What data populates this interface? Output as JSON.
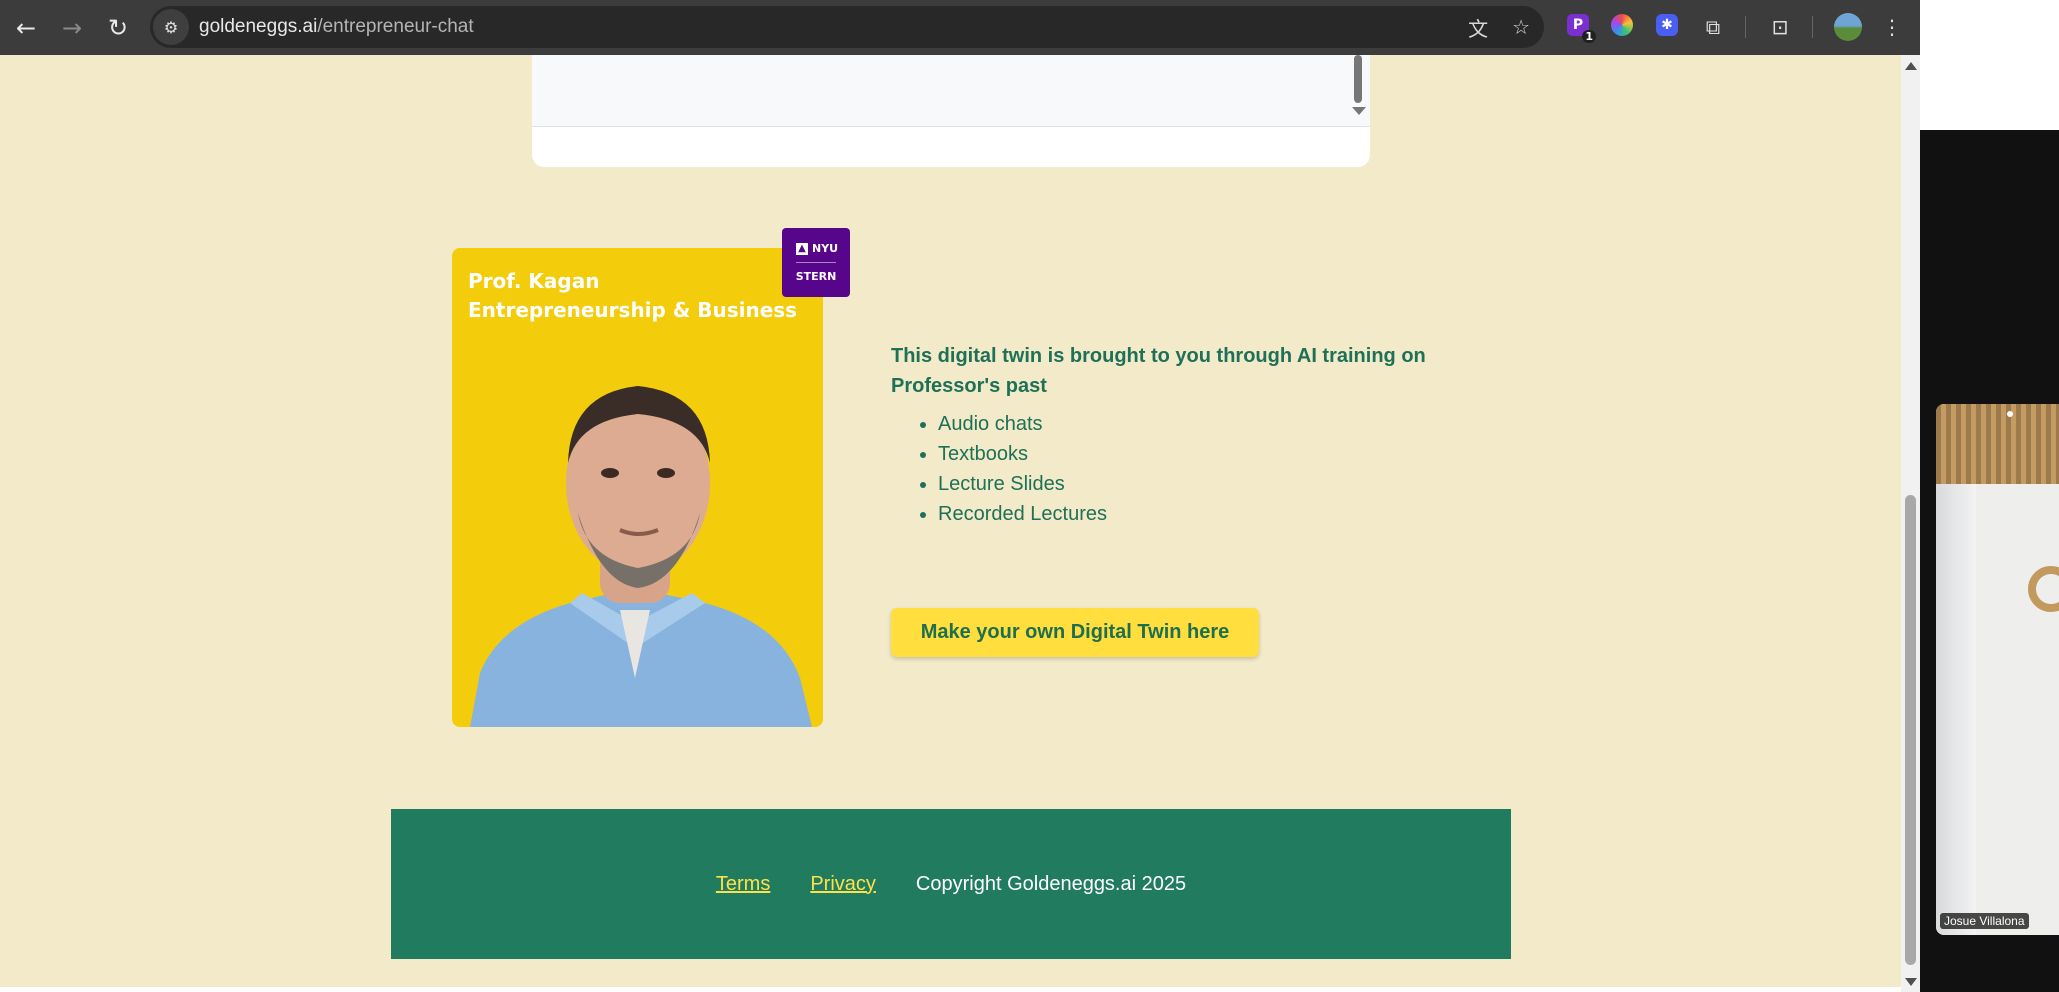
{
  "browser": {
    "url_domain": "goldeneggs.ai",
    "url_path": "/entrepreneur-chat",
    "back_icon": "arrow-left-icon",
    "forward_icon": "arrow-right-icon",
    "reload_icon": "reload-icon",
    "extension_badge": "1"
  },
  "professor_card": {
    "name": "Prof. Kagan",
    "subject": "Entrepreneurship & Business",
    "badge_top": "NYU",
    "badge_bottom": "STERN"
  },
  "info": {
    "heading": "This digital twin is brought to you through AI training on Professor's past",
    "items": [
      "Audio chats",
      "Textbooks",
      "Lecture Slides",
      "Recorded Lectures"
    ],
    "cta_label": "Make your own Digital Twin here"
  },
  "footer": {
    "terms": "Terms",
    "privacy": "Privacy",
    "copyright": "Copyright Goldeneggs.ai 2025"
  },
  "video_panel": {
    "participant_name": "Josue Villalona"
  },
  "colors": {
    "page_background": "#f2eac9",
    "accent_green": "#217b5e",
    "card_yellow": "#f3cc0c",
    "cta_yellow": "#ffde3d",
    "nyu_purple": "#57068c"
  }
}
